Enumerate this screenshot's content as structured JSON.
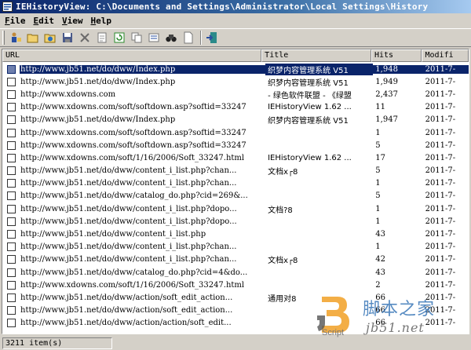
{
  "window": {
    "title": "IEHistoryView:  C:\\Documents and Settings\\Administrator\\Local Settings\\History"
  },
  "menu": [
    {
      "accel": "F",
      "rest": "ile"
    },
    {
      "accel": "E",
      "rest": "dit"
    },
    {
      "accel": "V",
      "rest": "iew"
    },
    {
      "accel": "H",
      "rest": "elp"
    }
  ],
  "toolbar": {
    "icons": [
      "choose-folder-icon",
      "open-folder-icon",
      "load-history-icon",
      "save-icon",
      "delete-icon",
      "properties-icon",
      "refresh-icon",
      "copy-icon",
      "select-all-icon",
      "find-icon",
      "html-report-icon",
      "exit-icon"
    ]
  },
  "columns": {
    "url": "URL",
    "title": "Title",
    "hits": "Hits",
    "modified": "Modifi"
  },
  "rows": [
    {
      "url": "http://www.jb51.net/do/dww/Index.php",
      "title": "织梦内容管理系统 V51",
      "hits": "1,948",
      "modified": "2011-7-"
    },
    {
      "url": "http://www.jb51.net/do/dww/Index.php",
      "title": "织梦内容管理系统 V51",
      "hits": "1,949",
      "modified": "2011-7-"
    },
    {
      "url": "http://www.xdowns.com",
      "title": "- 绿色软件联盟 - 《绿盟",
      "hits": "2,437",
      "modified": "2011-7-"
    },
    {
      "url": "http://www.xdowns.com/soft/softdown.asp?softid=33247",
      "title": "IEHistoryView 1.62 ...",
      "hits": "11",
      "modified": "2011-7-"
    },
    {
      "url": "http://www.jb51.net/do/dww/Index.php",
      "title": "织梦内容管理系统 V51",
      "hits": "1,947",
      "modified": "2011-7-"
    },
    {
      "url": "http://www.xdowns.com/soft/softdown.asp?softid=33247",
      "title": "",
      "hits": "1",
      "modified": "2011-7-"
    },
    {
      "url": "http://www.xdowns.com/soft/softdown.asp?softid=33247",
      "title": "",
      "hits": "5",
      "modified": "2011-7-"
    },
    {
      "url": "http://www.xdowns.com/soft/1/16/2006/Soft_33247.html",
      "title": "IEHistoryView 1.62 ...",
      "hits": "17",
      "modified": "2011-7-"
    },
    {
      "url": "http://www.jb51.net/do/dww/content_i_list.php?chan...",
      "title": "文档x┌8",
      "hits": "5",
      "modified": "2011-7-"
    },
    {
      "url": "http://www.jb51.net/do/dww/content_i_list.php?chan...",
      "title": "",
      "hits": "1",
      "modified": "2011-7-"
    },
    {
      "url": "http://www.jb51.net/do/dww/catalog_do.php?cid=269&...",
      "title": "",
      "hits": "5",
      "modified": "2011-7-"
    },
    {
      "url": "http://www.jb51.net/do/dww/content_i_list.php?dopo...",
      "title": "文档?8",
      "hits": "1",
      "modified": "2011-7-"
    },
    {
      "url": "http://www.jb51.net/do/dww/content_i_list.php?dopo...",
      "title": "",
      "hits": "1",
      "modified": "2011-7-"
    },
    {
      "url": "http://www.jb51.net/do/dww/content_i_list.php",
      "title": "",
      "hits": "43",
      "modified": "2011-7-"
    },
    {
      "url": "http://www.jb51.net/do/dww/content_i_list.php?chan...",
      "title": "",
      "hits": "1",
      "modified": "2011-7-"
    },
    {
      "url": "http://www.jb51.net/do/dww/content_i_list.php?chan...",
      "title": "文档x┌8",
      "hits": "42",
      "modified": "2011-7-"
    },
    {
      "url": "http://www.jb51.net/do/dww/catalog_do.php?cid=4&do...",
      "title": "",
      "hits": "43",
      "modified": "2011-7-"
    },
    {
      "url": "http://www.xdowns.com/soft/1/16/2006/Soft_33247.html",
      "title": "",
      "hits": "2",
      "modified": "2011-7-"
    },
    {
      "url": "http://www.jb51.net/do/dww/action/soft_edit_action...",
      "title": "通用对8",
      "hits": "66",
      "modified": "2011-7-"
    },
    {
      "url": "http://www.jb51.net/do/dww/action/soft_edit_action...",
      "title": "",
      "hits": "66",
      "modified": "2011-7-"
    },
    {
      "url": "http://www.jb51.net/do/dww/action/action/soft_edit...",
      "title": "",
      "hits": "66",
      "modified": "2011-7-"
    }
  ],
  "status": {
    "items": "3211 item(s)"
  },
  "watermark": {
    "script": "Script",
    "cn": "脚本之家",
    "domain": "jb51.net"
  },
  "colors": {
    "selection": "#0a246a",
    "face": "#d4d0c8"
  }
}
